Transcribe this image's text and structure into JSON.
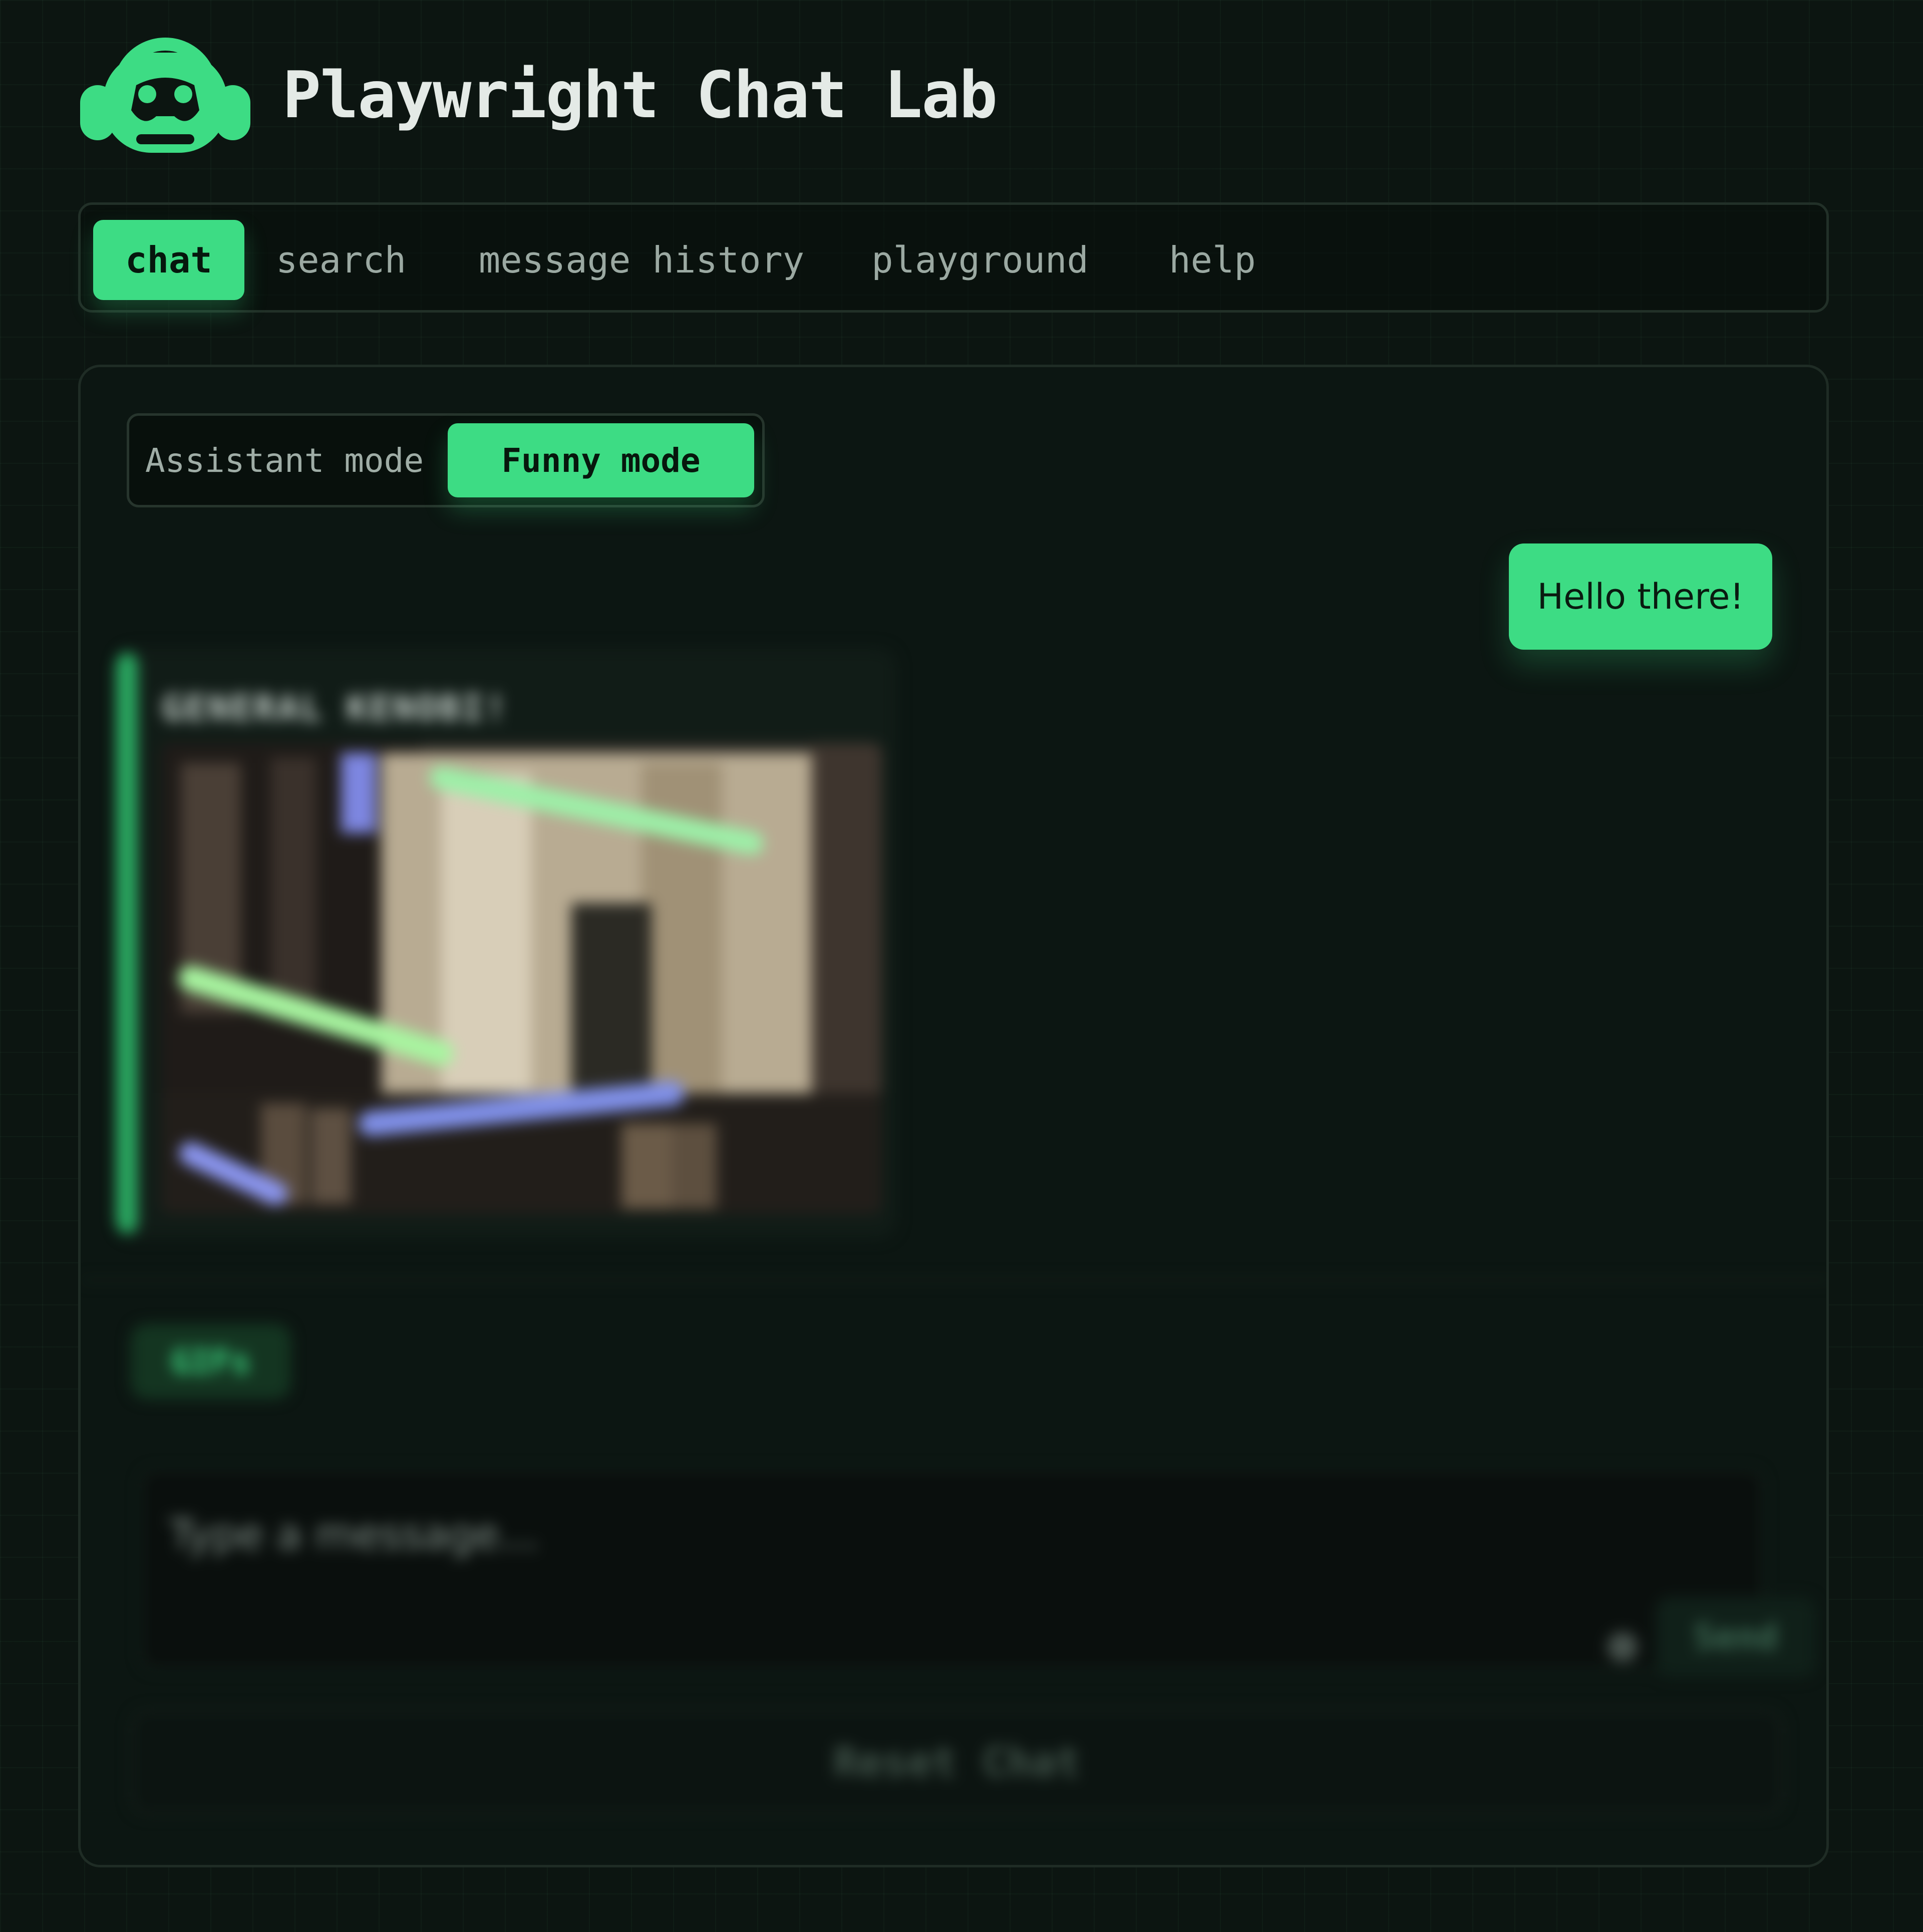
{
  "app": {
    "title": "Playwright Chat Lab",
    "accent_color": "#3ddc84"
  },
  "nav": {
    "tabs": [
      {
        "label": "chat",
        "active": true
      },
      {
        "label": "search",
        "active": false
      },
      {
        "label": "message history",
        "active": false
      },
      {
        "label": "playground",
        "active": false
      },
      {
        "label": "help",
        "active": false
      }
    ]
  },
  "mode": {
    "options": [
      "Assistant mode",
      "Funny mode"
    ],
    "selected": "Funny mode"
  },
  "chat": {
    "messages": [
      {
        "role": "user",
        "text": "Hello there!"
      },
      {
        "role": "bot",
        "label": "GENERAL KENOBI!",
        "content": "gif-image"
      }
    ]
  },
  "composer": {
    "gif_button": "GIFs",
    "placeholder": "Type a message...",
    "send_label": "Send",
    "reset_label": "Reset Chat"
  },
  "icons": {
    "logo": "robot-headset-icon",
    "mic": "mic-icon"
  }
}
